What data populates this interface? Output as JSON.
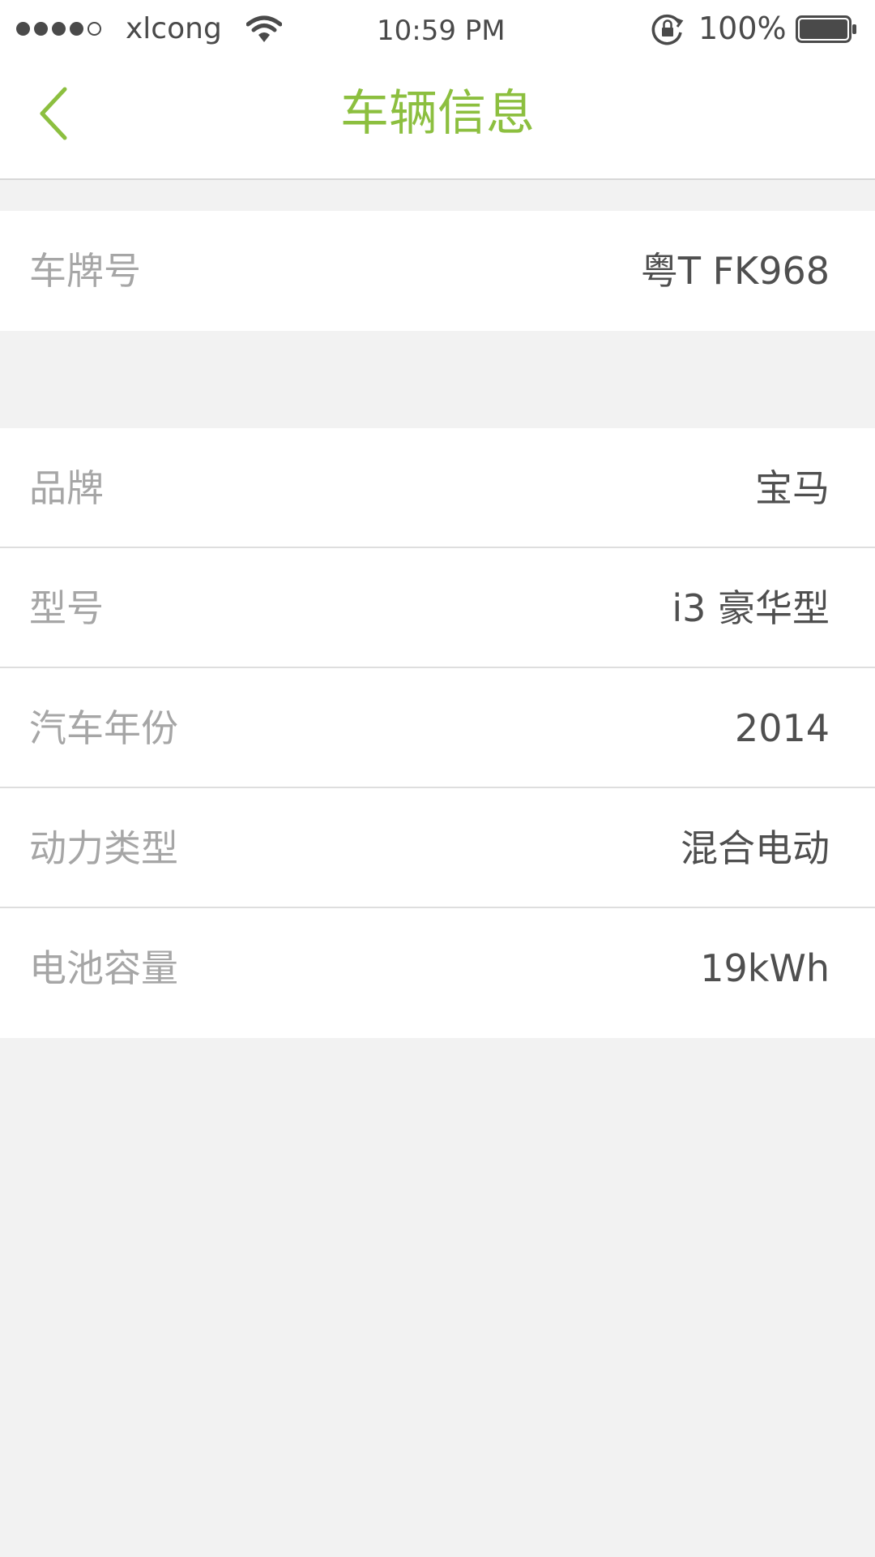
{
  "status_bar": {
    "carrier": "xlcong",
    "time": "10:59 PM",
    "battery_percent": "100%"
  },
  "nav": {
    "title": "车辆信息"
  },
  "plate_group": {
    "items": [
      {
        "label": "车牌号",
        "value": "粤T FK968"
      }
    ]
  },
  "vehicle_group": {
    "items": [
      {
        "label": "品牌",
        "value": "宝马"
      },
      {
        "label": "型号",
        "value": "i3 豪华型"
      },
      {
        "label": "汽车年份",
        "value": "2014"
      },
      {
        "label": "动力类型",
        "value": "混合电动"
      },
      {
        "label": "电池容量",
        "value": "19kWh"
      }
    ]
  },
  "colors": {
    "accent": "#8cbf3f",
    "label": "#a6a6a6",
    "value": "#4f4f4f",
    "background": "#f2f2f2"
  }
}
